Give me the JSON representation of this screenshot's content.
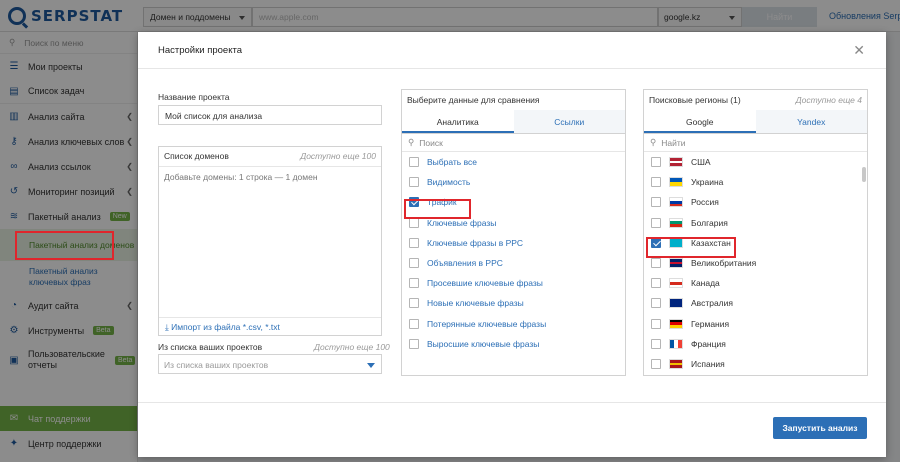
{
  "header": {
    "logo_text": "SERPSTAT",
    "domain_select": "Домен и поддомены",
    "url_placeholder": "www.apple.com",
    "engine_select": "google.kz",
    "find_button": "Найти",
    "updates_link": "Обновления Serpst"
  },
  "sidebar": {
    "search_placeholder": "Поиск по меню",
    "items": [
      {
        "label": "Мои проекты",
        "icon": "list-icon"
      },
      {
        "label": "Список задач",
        "icon": "tasks-icon"
      },
      {
        "label": "Анализ сайта",
        "icon": "chart-icon"
      },
      {
        "label": "Анализ ключевых слов",
        "icon": "key-icon"
      },
      {
        "label": "Анализ ссылок",
        "icon": "link-icon"
      },
      {
        "label": "Мониторинг позиций",
        "icon": "history-icon"
      },
      {
        "label": "Пакетный анализ",
        "icon": "layers-icon",
        "badge": "New"
      }
    ],
    "sub_items": [
      "Пакетный анализ доменов",
      "Пакетный анализ ключевых фраз"
    ],
    "items2": [
      {
        "label": "Аудит сайта",
        "icon": "audit-icon"
      },
      {
        "label": "Инструменты",
        "icon": "gear-icon",
        "badge": "Beta"
      },
      {
        "label": "Пользовательские отчеты",
        "icon": "report-icon",
        "badge": "Beta"
      }
    ],
    "chat_label": "Чат поддержки",
    "support_label": "Центр поддержки"
  },
  "modal": {
    "title": "Настройки проекта",
    "project_name_label": "Название проекта",
    "project_name_value": "Мой список для анализа",
    "domains_label": "Список доменов",
    "domains_avail": "Доступно еще 100",
    "domains_placeholder": "Добавьте домены: 1 строка — 1 домен",
    "import_link": "Импорт из файла *.csv, *.txt",
    "projects_label": "Из списка ваших проектов",
    "projects_avail": "Доступно еще 100",
    "projects_placeholder": "Из списка ваших проектов",
    "compare_title": "Выберите данные для сравнения",
    "compare_tabs": [
      "Аналитика",
      "Ссылки"
    ],
    "compare_search": "Поиск",
    "compare_options": [
      {
        "label": "Выбрать все",
        "checked": false
      },
      {
        "label": "Видимость",
        "checked": false
      },
      {
        "label": "Трафик",
        "checked": true
      },
      {
        "label": "Ключевые фразы",
        "checked": false
      },
      {
        "label": "Ключевые фразы в PPC",
        "checked": false
      },
      {
        "label": "Объявления в PPC",
        "checked": false
      },
      {
        "label": "Просевшие ключевые фразы",
        "checked": false
      },
      {
        "label": "Новые ключевые фразы",
        "checked": false
      },
      {
        "label": "Потерянные ключевые фразы",
        "checked": false
      },
      {
        "label": "Выросшие ключевые фразы",
        "checked": false
      }
    ],
    "regions_title": "Поисковые регионы (1)",
    "regions_avail": "Доступно еще 4",
    "region_tabs": [
      "Google",
      "Yandex"
    ],
    "region_search": "Найти",
    "regions": [
      {
        "label": "США",
        "checked": false,
        "flag": [
          "#b22234",
          "#ffffff",
          "#b22234"
        ],
        "flag_icon": "us-flag-icon"
      },
      {
        "label": "Украина",
        "checked": false,
        "flag": [
          "#0057b7",
          "#ffd700"
        ],
        "flag_icon": "ua-flag-icon"
      },
      {
        "label": "Россия",
        "checked": false,
        "flag": [
          "#ffffff",
          "#0039a6",
          "#d52b1e"
        ],
        "flag_icon": "ru-flag-icon"
      },
      {
        "label": "Болгария",
        "checked": false,
        "flag": [
          "#ffffff",
          "#00966e",
          "#d62612"
        ],
        "flag_icon": "bg-flag-icon"
      },
      {
        "label": "Казахстан",
        "checked": true,
        "flag": [
          "#00afca"
        ],
        "flag_icon": "kz-flag-icon"
      },
      {
        "label": "Великобритания",
        "checked": false,
        "flag": [
          "#012169",
          "#c8102e",
          "#012169"
        ],
        "flag_icon": "gb-flag-icon"
      },
      {
        "label": "Канада",
        "checked": false,
        "flag": [
          "#ffffff",
          "#d52b1e",
          "#ffffff"
        ],
        "flag_icon": "ca-flag-icon"
      },
      {
        "label": "Австралия",
        "checked": false,
        "flag": [
          "#00247d"
        ],
        "flag_icon": "au-flag-icon"
      },
      {
        "label": "Германия",
        "checked": false,
        "flag": [
          "#000000",
          "#dd0000",
          "#ffce00"
        ],
        "flag_icon": "de-flag-icon"
      },
      {
        "label": "Франция",
        "checked": false,
        "flag": [
          "#0055a4",
          "#ffffff",
          "#ef4135"
        ],
        "flag_icon": "fr-flag-icon",
        "vertical": true
      },
      {
        "label": "Испания",
        "checked": false,
        "flag": [
          "#aa151b",
          "#f1bf00",
          "#aa151b"
        ],
        "flag_icon": "es-flag-icon"
      }
    ],
    "run_button": "Запустить анализ"
  },
  "colors": {
    "brand": "#1e5a9e",
    "accent": "#2c6fb6",
    "green": "#75b547",
    "highlight": "#e0262c"
  }
}
